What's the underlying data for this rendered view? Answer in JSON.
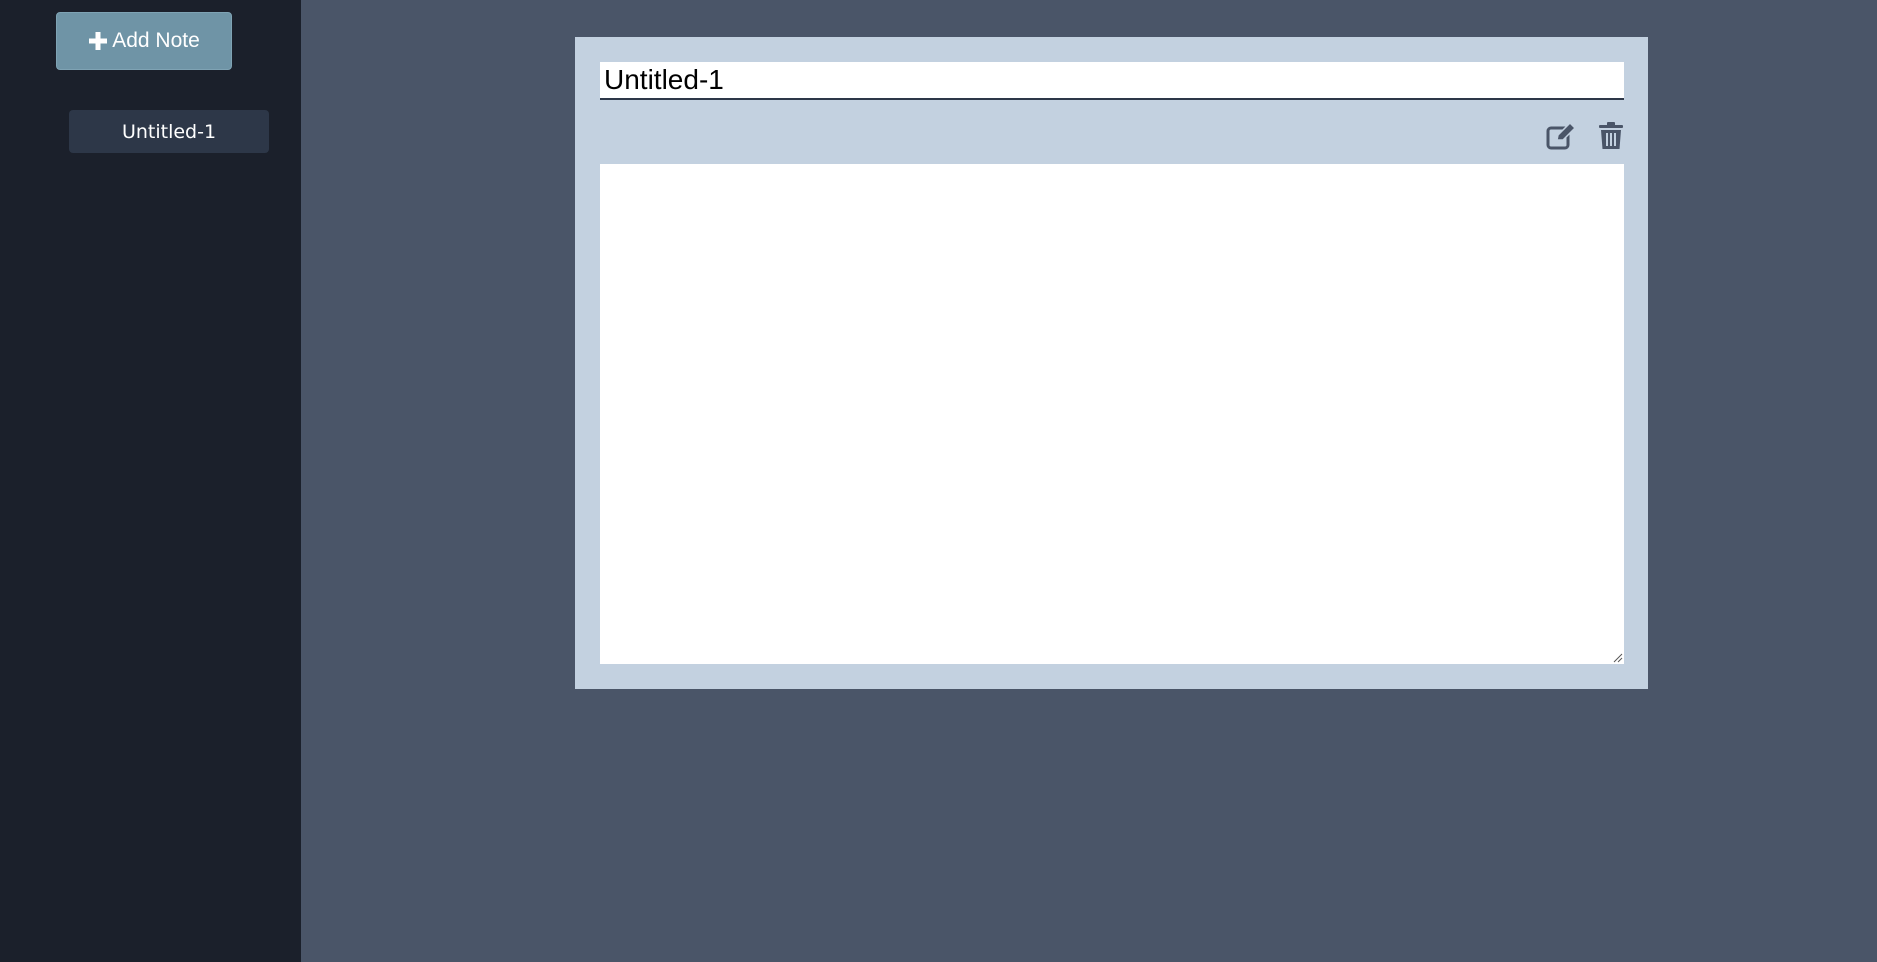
{
  "sidebar": {
    "add_button": {
      "label": "Add Note",
      "icon": "plus-icon"
    },
    "notes": [
      {
        "title": "Untitled-1"
      }
    ]
  },
  "editor": {
    "title_value": "Untitled-1",
    "body_value": "",
    "toolbar": {
      "edit_icon": "edit-icon",
      "delete_icon": "trash-icon"
    }
  },
  "colors": {
    "sidebar_bg": "#1b202b",
    "main_bg": "#4a5568",
    "accent_button": "#6f94a6",
    "note_item_bg": "#2d3748",
    "card_bg": "#c3d1e0"
  }
}
